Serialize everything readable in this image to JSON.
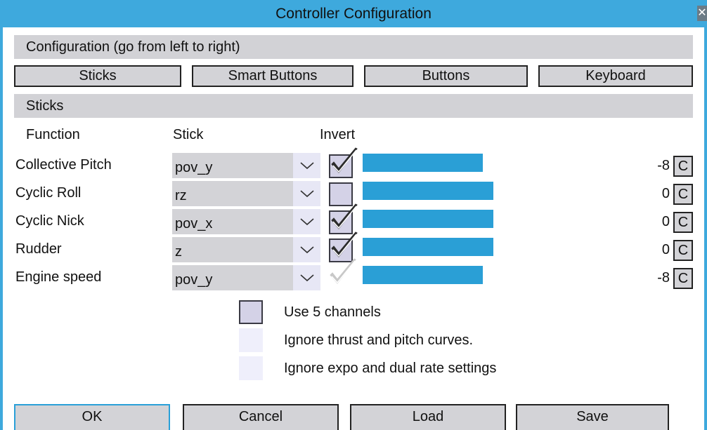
{
  "window": {
    "title": "Controller Configuration",
    "close_glyph": "✕"
  },
  "config_header": "Configuration (go from left to right)",
  "tabs": [
    "Sticks",
    "Smart Buttons",
    "Buttons",
    "Keyboard"
  ],
  "sticks_header": "Sticks",
  "columns": {
    "function": "Function",
    "stick": "Stick",
    "invert": "Invert"
  },
  "rows": [
    {
      "function": "Collective Pitch",
      "stick": "pov_y",
      "invert": "checked",
      "level": 0.92,
      "value": "-8",
      "calib": "C"
    },
    {
      "function": "Cyclic Roll",
      "stick": "rz",
      "invert": "unchecked",
      "level": 1.0,
      "value": "0",
      "calib": "C"
    },
    {
      "function": "Cyclic Nick",
      "stick": "pov_x",
      "invert": "checked",
      "level": 1.0,
      "value": "0",
      "calib": "C"
    },
    {
      "function": "Rudder",
      "stick": "z",
      "invert": "checked",
      "level": 1.0,
      "value": "0",
      "calib": "C"
    },
    {
      "function": "Engine speed",
      "stick": "pov_y",
      "invert": "disabled-checked",
      "level": 0.92,
      "value": "-8",
      "calib": "C"
    }
  ],
  "options": [
    {
      "label": "Use 5 channels",
      "state": "unchecked"
    },
    {
      "label": "Ignore thrust and pitch curves.",
      "state": "disabled"
    },
    {
      "label": "Ignore expo and dual rate settings",
      "state": "disabled"
    }
  ],
  "footer": {
    "ok": "OK",
    "cancel": "Cancel",
    "load": "Load",
    "save": "Save"
  },
  "colors": {
    "title_bar": "#3ea9dd",
    "level_bar": "#2a9fd6",
    "panel": "#d2d2d6",
    "checkbox": "#d4d2e7"
  },
  "icons": {
    "dropdown": "chevron-down-icon",
    "checkmark": "checkmark-icon",
    "close": "close-icon"
  }
}
